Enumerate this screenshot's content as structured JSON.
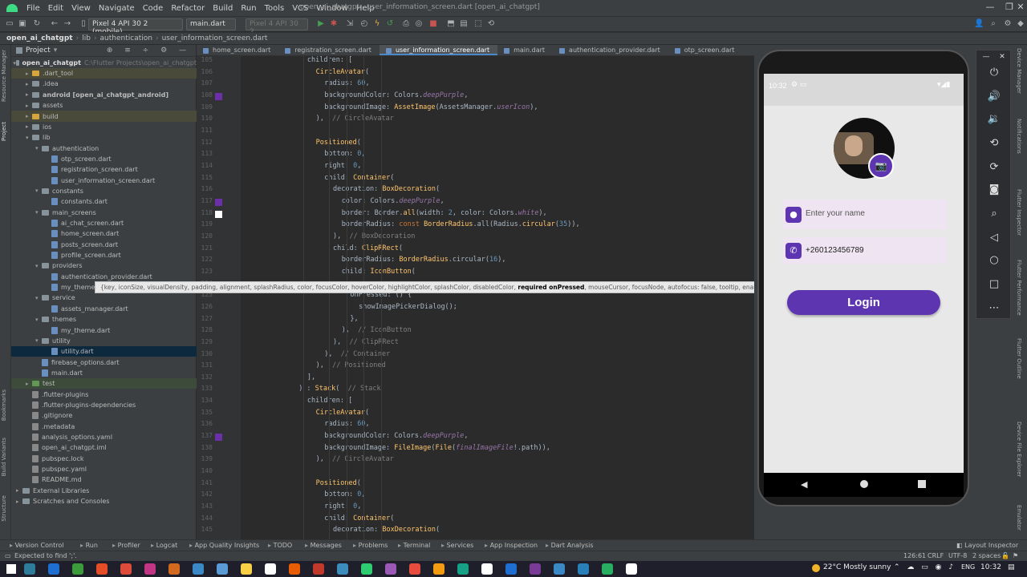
{
  "window": {
    "title": "open_ai_chatgpt - user_information_screen.dart [open_ai_chatgpt]",
    "menu": [
      "File",
      "Edit",
      "View",
      "Navigate",
      "Code",
      "Refactor",
      "Build",
      "Run",
      "Tools",
      "VCS",
      "Window",
      "Help"
    ]
  },
  "toolbar": {
    "device": "Pixel 4 API 30 2 (mobile)",
    "run_config": "main.dart",
    "device2": "Pixel 4 API 30 2"
  },
  "breadcrumb": [
    "open_ai_chatgpt",
    "lib",
    "authentication",
    "user_information_screen.dart"
  ],
  "project": {
    "header": "Project",
    "root_name": "open_ai_chatgpt",
    "root_path": "C:\\Flutter Projects\\open_ai_chatgpt",
    "items": [
      {
        "label": ".dart_tool",
        "depth": 1,
        "kind": "folder-orange",
        "arrow": "▸",
        "hl": "yellow"
      },
      {
        "label": ".idea",
        "depth": 1,
        "kind": "folder",
        "arrow": "▸"
      },
      {
        "label": "android [open_ai_chatgpt_android]",
        "depth": 1,
        "kind": "folder",
        "arrow": "▸",
        "bold": true
      },
      {
        "label": "assets",
        "depth": 1,
        "kind": "folder",
        "arrow": "▸"
      },
      {
        "label": "build",
        "depth": 1,
        "kind": "folder-orange",
        "arrow": "▸",
        "hl": "yellow"
      },
      {
        "label": "ios",
        "depth": 1,
        "kind": "folder",
        "arrow": "▸"
      },
      {
        "label": "lib",
        "depth": 1,
        "kind": "folder",
        "arrow": "▾"
      },
      {
        "label": "authentication",
        "depth": 2,
        "kind": "folder",
        "arrow": "▾"
      },
      {
        "label": "otp_screen.dart",
        "depth": 3,
        "kind": "file"
      },
      {
        "label": "registration_screen.dart",
        "depth": 3,
        "kind": "file"
      },
      {
        "label": "user_information_screen.dart",
        "depth": 3,
        "kind": "file"
      },
      {
        "label": "constants",
        "depth": 2,
        "kind": "folder",
        "arrow": "▾"
      },
      {
        "label": "constants.dart",
        "depth": 3,
        "kind": "file"
      },
      {
        "label": "main_screens",
        "depth": 2,
        "kind": "folder",
        "arrow": "▾"
      },
      {
        "label": "ai_chat_screen.dart",
        "depth": 3,
        "kind": "file"
      },
      {
        "label": "home_screen.dart",
        "depth": 3,
        "kind": "file"
      },
      {
        "label": "posts_screen.dart",
        "depth": 3,
        "kind": "file"
      },
      {
        "label": "profile_screen.dart",
        "depth": 3,
        "kind": "file"
      },
      {
        "label": "providers",
        "depth": 2,
        "kind": "folder",
        "arrow": "▾"
      },
      {
        "label": "authentication_provider.dart",
        "depth": 3,
        "kind": "file"
      },
      {
        "label": "my_theme",
        "depth": 3,
        "kind": "file"
      },
      {
        "label": "service",
        "depth": 2,
        "kind": "folder",
        "arrow": "▾"
      },
      {
        "label": "assets_manager.dart",
        "depth": 3,
        "kind": "file"
      },
      {
        "label": "themes",
        "depth": 2,
        "kind": "folder",
        "arrow": "▾"
      },
      {
        "label": "my_theme.dart",
        "depth": 3,
        "kind": "file"
      },
      {
        "label": "utility",
        "depth": 2,
        "kind": "folder",
        "arrow": "▾"
      },
      {
        "label": "utility.dart",
        "depth": 3,
        "kind": "file",
        "hl": "selected"
      },
      {
        "label": "firebase_options.dart",
        "depth": 2,
        "kind": "file"
      },
      {
        "label": "main.dart",
        "depth": 2,
        "kind": "file"
      },
      {
        "label": "test",
        "depth": 1,
        "kind": "folder-green",
        "arrow": "▸",
        "hl": "green"
      },
      {
        "label": ".flutter-plugins",
        "depth": 1,
        "kind": "file-gray"
      },
      {
        "label": ".flutter-plugins-dependencies",
        "depth": 1,
        "kind": "file-gray"
      },
      {
        "label": ".gitignore",
        "depth": 1,
        "kind": "file-gray"
      },
      {
        "label": ".metadata",
        "depth": 1,
        "kind": "file-gray"
      },
      {
        "label": "analysis_options.yaml",
        "depth": 1,
        "kind": "file-gray"
      },
      {
        "label": "open_ai_chatgpt.iml",
        "depth": 1,
        "kind": "file-gray"
      },
      {
        "label": "pubspec.lock",
        "depth": 1,
        "kind": "file-gray"
      },
      {
        "label": "pubspec.yaml",
        "depth": 1,
        "kind": "file-gray"
      },
      {
        "label": "README.md",
        "depth": 1,
        "kind": "file-gray"
      },
      {
        "label": "External Libraries",
        "depth": 0,
        "kind": "folder",
        "arrow": "▸"
      },
      {
        "label": "Scratches and Consoles",
        "depth": 0,
        "kind": "folder",
        "arrow": "▸"
      }
    ]
  },
  "left_strip_tabs": [
    "Resource Manager",
    "Project",
    "Bookmarks",
    "Build Variants",
    "Structure"
  ],
  "right_strip_tabs": [
    "Device Manager",
    "Notifications",
    "Flutter Inspector",
    "Flutter Performance",
    "Flutter Outline",
    "Device File Explorer",
    "Emulator"
  ],
  "tabs": [
    {
      "label": "home_screen.dart",
      "active": false
    },
    {
      "label": "registration_screen.dart",
      "active": false
    },
    {
      "label": "user_information_screen.dart",
      "active": true
    },
    {
      "label": "main.dart",
      "active": false
    },
    {
      "label": "authentication_provider.dart",
      "active": false
    },
    {
      "label": "otp_screen.dart",
      "active": false
    }
  ],
  "code_lines": [
    {
      "n": "105",
      "ind": 7,
      "html": "children: ["
    },
    {
      "n": "106",
      "ind": 8,
      "html": "<span class='fn'>CircleAvatar</span>("
    },
    {
      "n": "107",
      "ind": 9,
      "html": "radius: <span class='num'>60</span>,"
    },
    {
      "n": "108",
      "ind": 9,
      "html": "backgroundColor: Colors.<span class='pp'>deepPurple</span>,",
      "sq": "#6b2fa8"
    },
    {
      "n": "109",
      "ind": 9,
      "html": "backgroundImage: <span class='fn'>AssetImage</span>(AssetsManager.<span class='pp'>userIcon</span>),"
    },
    {
      "n": "110",
      "ind": 8,
      "html": "),  <span class='cm'>// CircleAvatar</span>"
    },
    {
      "n": "111",
      "ind": 0,
      "html": ""
    },
    {
      "n": "112",
      "ind": 8,
      "html": "<span class='fn'>Positioned</span>("
    },
    {
      "n": "113",
      "ind": 9,
      "html": "bottom: <span class='num'>0</span>,"
    },
    {
      "n": "114",
      "ind": 9,
      "html": "right: <span class='num'>0</span>,"
    },
    {
      "n": "115",
      "ind": 9,
      "html": "child: <span class='fn'>Container</span>("
    },
    {
      "n": "116",
      "ind": 10,
      "html": "decoration: <span class='fn'>BoxDecoration</span>("
    },
    {
      "n": "117",
      "ind": 11,
      "html": "color: Colors.<span class='pp'>deepPurple</span>,",
      "sq": "#6b2fa8"
    },
    {
      "n": "118",
      "ind": 11,
      "html": "border: Border.<span class='fn'>all</span>(width: <span class='num'>2</span>, color: Colors.<span class='pp'>white</span>),",
      "sq": "#ffffff"
    },
    {
      "n": "119",
      "ind": 11,
      "html": "borderRadius: <span class='kw'>const</span> <span class='fn'>BorderRadius</span>.all(Radius.<span class='fn'>circular</span>(<span class='num'>35</span>)),"
    },
    {
      "n": "120",
      "ind": 10,
      "html": "),  <span class='cm'>// BoxDecoration</span>"
    },
    {
      "n": "121",
      "ind": 10,
      "html": "child: <span class='fn'>ClipRRect</span>("
    },
    {
      "n": "122",
      "ind": 11,
      "html": "borderRadius: <span class='fn'>BorderRadius</span>.circular(<span class='num'>16</span>),"
    },
    {
      "n": "123",
      "ind": 11,
      "html": "child: <span class='fn'>IconButton</span>("
    },
    {
      "n": "124",
      "ind": 12,
      "html": ""
    },
    {
      "n": "125",
      "ind": 12,
      "html": "onPressed: () {"
    },
    {
      "n": "126",
      "ind": 13,
      "html": "showImagePickerDialog();"
    },
    {
      "n": "127",
      "ind": 12,
      "html": "},"
    },
    {
      "n": "128",
      "ind": 11,
      "html": "),  <span class='cm'>// IconButton</span>"
    },
    {
      "n": "129",
      "ind": 10,
      "html": "),  <span class='cm'>// ClipRRect</span>"
    },
    {
      "n": "130",
      "ind": 9,
      "html": "),  <span class='cm'>// Container</span>"
    },
    {
      "n": "131",
      "ind": 8,
      "html": "),  <span class='cm'>// Positioned</span>"
    },
    {
      "n": "132",
      "ind": 7,
      "html": "],"
    },
    {
      "n": "133",
      "ind": 6,
      "html": ") : <span class='fn'>Stack</span>(  <span class='cm'>// Stack</span>"
    },
    {
      "n": "134",
      "ind": 7,
      "html": "children: ["
    },
    {
      "n": "135",
      "ind": 8,
      "html": "<span class='fn'>CircleAvatar</span>("
    },
    {
      "n": "136",
      "ind": 9,
      "html": "radius: <span class='num'>60</span>,"
    },
    {
      "n": "137",
      "ind": 9,
      "html": "backgroundColor: Colors.<span class='pp'>deepPurple</span>,",
      "sq": "#6b2fa8"
    },
    {
      "n": "138",
      "ind": 9,
      "html": "backgroundImage: <span class='fn'>FileImage</span>(<span class='fn'>File</span>(<span class='pp'>finalImageFile</span>!.path)),"
    },
    {
      "n": "139",
      "ind": 8,
      "html": "),  <span class='cm'>// CircleAvatar</span>"
    },
    {
      "n": "140",
      "ind": 0,
      "html": ""
    },
    {
      "n": "141",
      "ind": 8,
      "html": "<span class='fn'>Positioned</span>("
    },
    {
      "n": "142",
      "ind": 9,
      "html": "bottom: <span class='num'>0</span>,"
    },
    {
      "n": "143",
      "ind": 9,
      "html": "right: <span class='num'>0</span>,"
    },
    {
      "n": "144",
      "ind": 9,
      "html": "child: <span class='fn'>Container</span>("
    },
    {
      "n": "145",
      "ind": 10,
      "html": "decoration: <span class='fn'>BoxDecoration</span>("
    }
  ],
  "param_popup": {
    "pre": "{key, iconSize, visualDensity, padding, alignment, splashRadius, color, focusColor, hoverColor, highlightColor, splashColor, disabledColor, ",
    "bold": "required onPressed",
    "post": ", mouseCursor, focusNode, autofocus: false, tooltip, enableFeedback, con"
  },
  "phone": {
    "time": "10:32",
    "name_placeholder": "Enter your name",
    "phone_value": "+260123456789",
    "login_label": "Login",
    "accent": "#5e35b1"
  },
  "bottom_tools": [
    "Version Control",
    "Run",
    "Profiler",
    "Logcat",
    "App Quality Insights",
    "TODO",
    "Messages",
    "Problems",
    "Terminal",
    "Services",
    "App Inspection",
    "Dart Analysis"
  ],
  "layout_inspector": "Layout Inspector",
  "status": {
    "message": "Expected to find ';'.",
    "position": "126:61",
    "line_sep": "CRLF",
    "encoding": "UTF-8",
    "indent": "2 spaces"
  },
  "taskbar": {
    "weather": "22°C  Mostly sunny",
    "lang": "ENG",
    "time": "10:32"
  }
}
